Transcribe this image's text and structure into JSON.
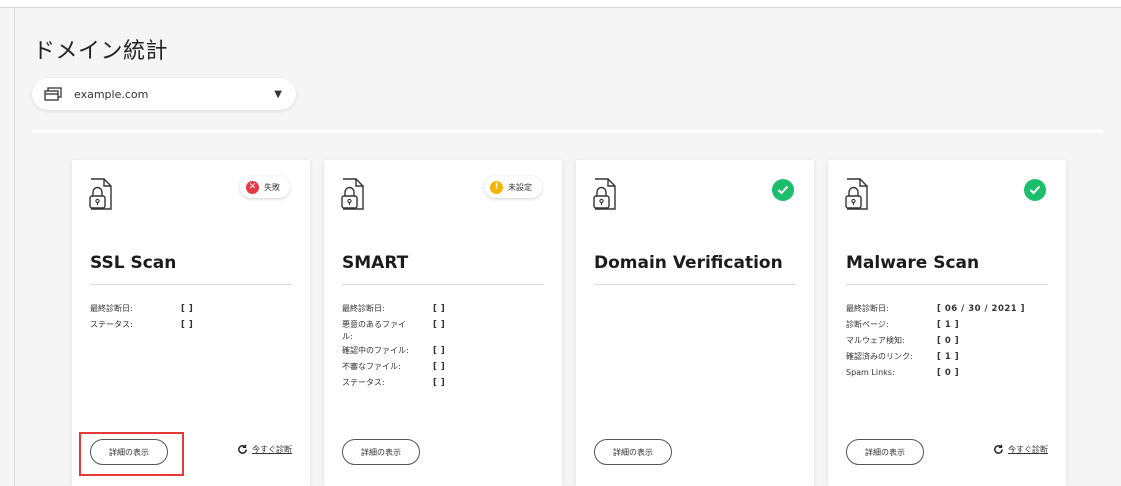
{
  "page": {
    "title": "ドメイン統計"
  },
  "domain_selector": {
    "value": "example.com",
    "icon": "window-stack-icon"
  },
  "colors": {
    "fail": "#e53945",
    "warning": "#f6b400",
    "success": "#1bbf6b",
    "highlight": "#e53935"
  },
  "cards": [
    {
      "title": "SSL Scan",
      "status": {
        "type": "fail",
        "label": "失敗"
      },
      "stats": [
        {
          "label": "最終診断日:",
          "value": "[ ]"
        },
        {
          "label": "ステータス:",
          "value": "[ ]"
        }
      ],
      "details_label": "詳細の表示",
      "scan_now_label": "今すぐ診断"
    },
    {
      "title": "SMART",
      "status": {
        "type": "warning",
        "label": "未設定"
      },
      "stats": [
        {
          "label": "最終診断日:",
          "value": "[ ]"
        },
        {
          "label": "悪意のあるファイル:",
          "value": "[ ]"
        },
        {
          "label": "確認中のファイル:",
          "value": "[ ]"
        },
        {
          "label": "不審なファイル:",
          "value": "[ ]"
        },
        {
          "label": "ステータス:",
          "value": "[ ]"
        }
      ],
      "details_label": "詳細の表示"
    },
    {
      "title": "Domain Verification",
      "status": {
        "type": "success"
      },
      "stats": [],
      "details_label": "詳細の表示"
    },
    {
      "title": "Malware Scan",
      "status": {
        "type": "success"
      },
      "stats": [
        {
          "label": "最終診断日:",
          "value": "[ 06 / 30 / 2021 ]"
        },
        {
          "label": "診断ページ:",
          "value": "[ 1 ]"
        },
        {
          "label": "マルウェア検知:",
          "value": "[ 0 ]"
        },
        {
          "label": "確認済みのリンク:",
          "value": "[ 1 ]"
        },
        {
          "label": "Spam Links:",
          "value": "[ 0 ]"
        }
      ],
      "details_label": "詳細の表示",
      "scan_now_label": "今すぐ診断"
    }
  ]
}
